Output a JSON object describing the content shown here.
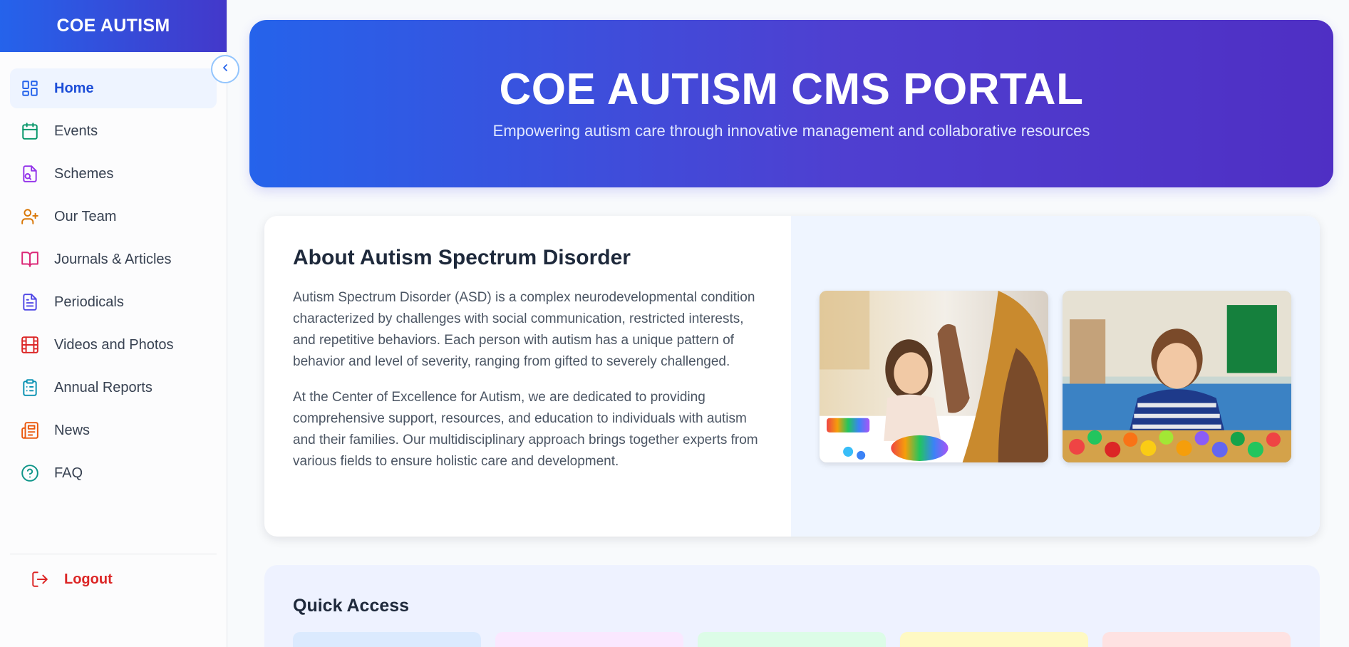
{
  "sidebar": {
    "brand": "COE AUTISM",
    "items": [
      {
        "label": "Home",
        "icon": "layout-grid-icon",
        "color": "#2563eb",
        "active": true
      },
      {
        "label": "Events",
        "icon": "calendar-icon",
        "color": "#059669"
      },
      {
        "label": "Schemes",
        "icon": "file-search-icon",
        "color": "#9333ea"
      },
      {
        "label": "Our Team",
        "icon": "user-plus-icon",
        "color": "#d97706"
      },
      {
        "label": "Journals & Articles",
        "icon": "book-open-icon",
        "color": "#db2777"
      },
      {
        "label": "Periodicals",
        "icon": "file-text-icon",
        "color": "#4f46e5"
      },
      {
        "label": "Videos and Photos",
        "icon": "film-icon",
        "color": "#dc2626"
      },
      {
        "label": "Annual Reports",
        "icon": "clipboard-list-icon",
        "color": "#0891b2"
      },
      {
        "label": "News",
        "icon": "newspaper-icon",
        "color": "#ea580c"
      },
      {
        "label": "FAQ",
        "icon": "help-circle-icon",
        "color": "#0d9488"
      }
    ],
    "logout": {
      "label": "Logout",
      "icon": "log-out-icon",
      "color": "#dc2626"
    }
  },
  "hero": {
    "title": "COE AUTISM CMS PORTAL",
    "subtitle": "Empowering autism care through innovative management and collaborative resources"
  },
  "about": {
    "heading": "About Autism Spectrum Disorder",
    "paragraph1": "Autism Spectrum Disorder (ASD) is a complex neurodevelopmental condition characterized by challenges with social communication, restricted interests, and repetitive behaviors. Each person with autism has a unique pattern of behavior and level of severity, ranging from gifted to severely challenged.",
    "paragraph2": "At the Center of Excellence for Autism, we are dedicated to providing comprehensive support, resources, and education to individuals with autism and their families. Our multidisciplinary approach brings together experts from various fields to ensure holistic care and development."
  },
  "quick_access": {
    "heading": "Quick Access",
    "tile_colors": [
      "#dbeafe",
      "#fae8ff",
      "#dcfce7",
      "#fef9c3",
      "#fee2e2"
    ]
  }
}
